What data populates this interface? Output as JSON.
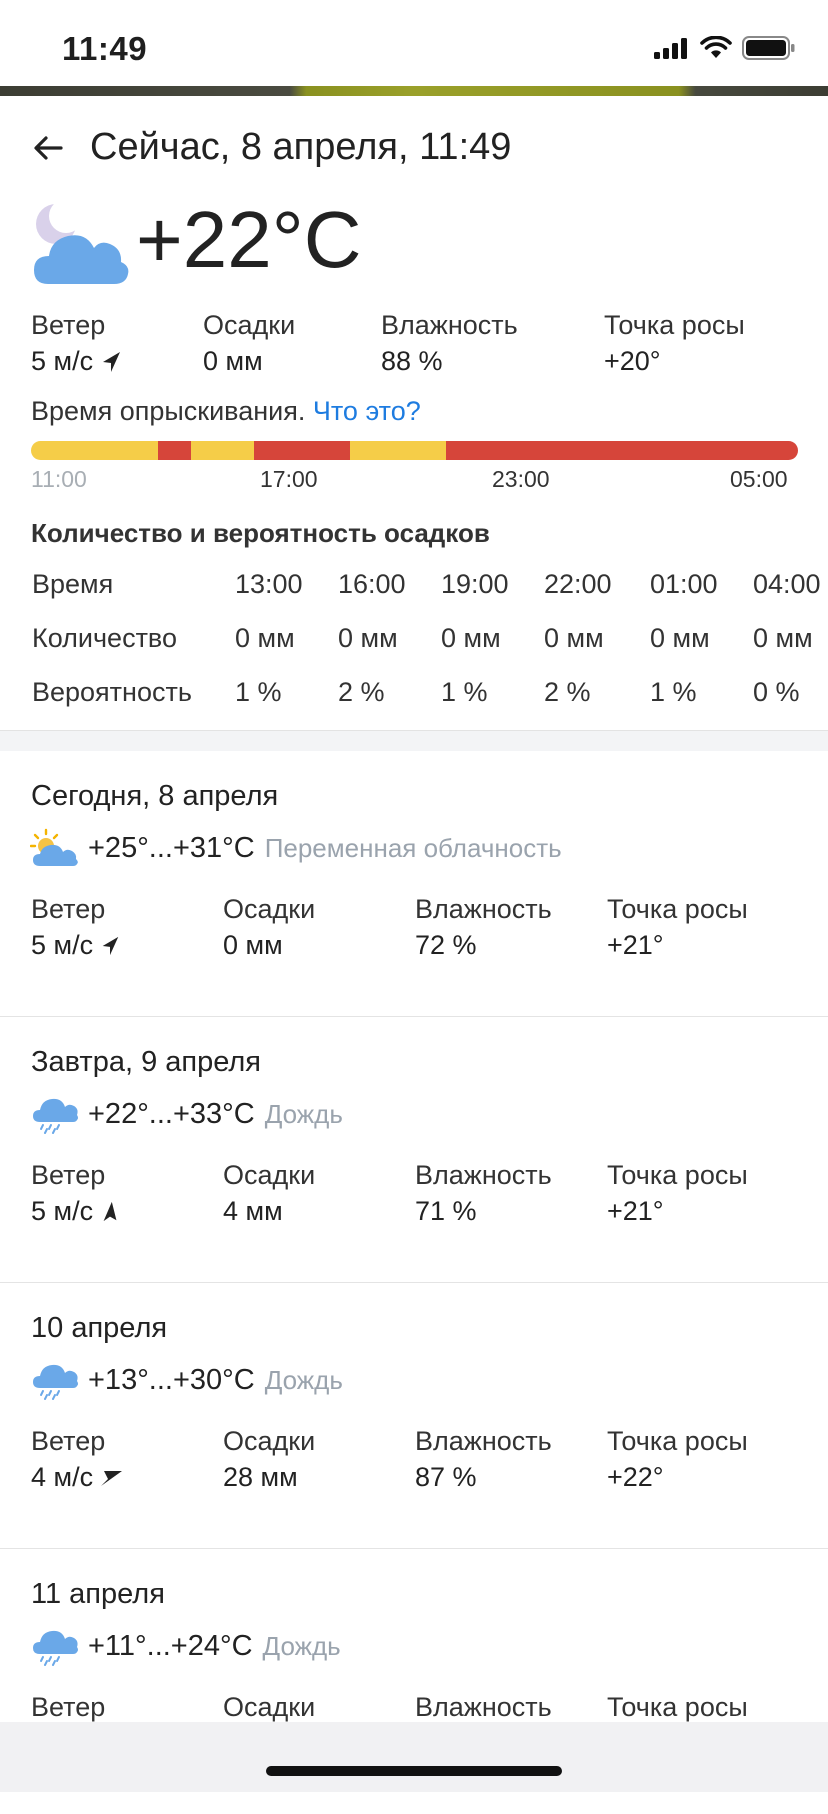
{
  "status_bar": {
    "time": "11:49"
  },
  "header": {
    "title": "Сейчас, 8 апреля, 11:49"
  },
  "current": {
    "icon": "moon-cloud-icon",
    "temperature": "+22°C",
    "stats": [
      {
        "label": "Ветер",
        "value": "5 м/с",
        "arrow": "wind-arrow-icon"
      },
      {
        "label": "Осадки",
        "value": "0 мм"
      },
      {
        "label": "Влажность",
        "value": "88 %"
      },
      {
        "label": "Точка росы",
        "value": "+20°"
      }
    ]
  },
  "spraying": {
    "title": "Время опрыскивания.",
    "link": "Что это?",
    "segments": [
      {
        "color": "#f5cd48",
        "fraction": 0.166
      },
      {
        "color": "#d6453a",
        "fraction": 0.042
      },
      {
        "color": "#f5cd48",
        "fraction": 0.083
      },
      {
        "color": "#d6453a",
        "fraction": 0.125
      },
      {
        "color": "#f5cd48",
        "fraction": 0.125
      },
      {
        "color": "#d6453a",
        "fraction": 0.459
      }
    ],
    "ticks": [
      "11:00",
      "17:00",
      "23:00",
      "05:00"
    ]
  },
  "precipitation": {
    "title": "Количество и вероятность осадков",
    "rows": [
      {
        "label": "Время",
        "values": [
          "13:00",
          "16:00",
          "19:00",
          "22:00",
          "01:00",
          "04:00"
        ]
      },
      {
        "label": "Количество",
        "values": [
          "0 мм",
          "0 мм",
          "0 мм",
          "0 мм",
          "0 мм",
          "0 мм"
        ]
      },
      {
        "label": "Вероятность",
        "values": [
          "1 %",
          "2 %",
          "1 %",
          "2 %",
          "1 %",
          "0 %"
        ]
      }
    ]
  },
  "days": [
    {
      "date": "Сегодня, 8 апреля",
      "icon": "sun-cloud-icon",
      "temp": "+25°...+31°C",
      "desc": "Переменная облачность",
      "stats": [
        {
          "label": "Ветер",
          "value": "5 м/с"
        },
        {
          "label": "Осадки",
          "value": "0 мм"
        },
        {
          "label": "Влажность",
          "value": "72 %"
        },
        {
          "label": "Точка росы",
          "value": "+21°"
        }
      ]
    },
    {
      "date": "Завтра, 9 апреля",
      "icon": "rain-cloud-icon",
      "temp": "+22°...+33°C",
      "desc": "Дождь",
      "stats": [
        {
          "label": "Ветер",
          "value": "5 м/с"
        },
        {
          "label": "Осадки",
          "value": "4 мм"
        },
        {
          "label": "Влажность",
          "value": "71 %"
        },
        {
          "label": "Точка росы",
          "value": "+21°"
        }
      ]
    },
    {
      "date": "10 апреля",
      "icon": "rain-cloud-icon",
      "temp": "+13°...+30°C",
      "desc": "Дождь",
      "stats": [
        {
          "label": "Ветер",
          "value": "4 м/с"
        },
        {
          "label": "Осадки",
          "value": "28 мм"
        },
        {
          "label": "Влажность",
          "value": "87 %"
        },
        {
          "label": "Точка росы",
          "value": "+22°"
        }
      ]
    },
    {
      "date": "11 апреля",
      "icon": "rain-cloud-icon",
      "temp": "+11°...+24°C",
      "desc": "Дождь",
      "stats": [
        {
          "label": "Ветер",
          "value": ""
        },
        {
          "label": "Осадки",
          "value": ""
        },
        {
          "label": "Влажность",
          "value": ""
        },
        {
          "label": "Точка росы",
          "value": ""
        }
      ]
    }
  ]
}
